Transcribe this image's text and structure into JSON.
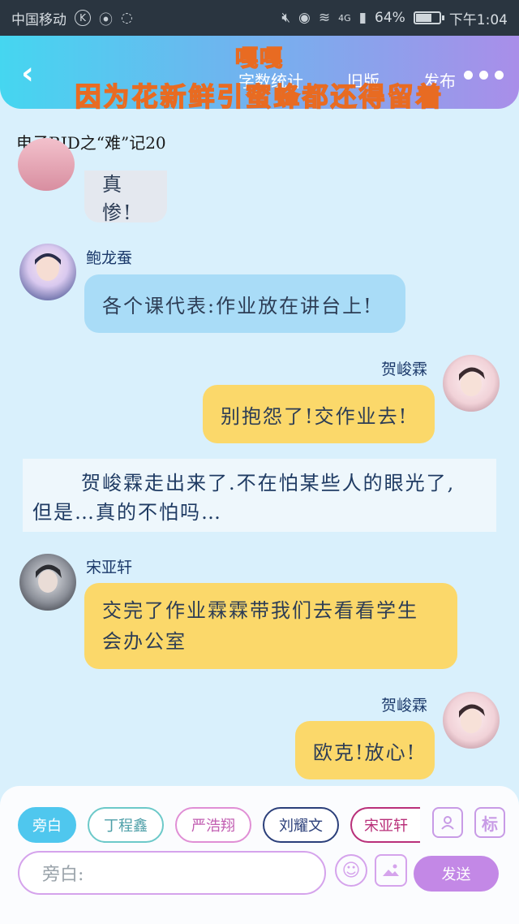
{
  "status_bar": {
    "carrier": "中国移动",
    "carrier_badge": "K",
    "battery_percent": "64%",
    "network": "4G",
    "time": "下午1:04",
    "icons": [
      "mute-icon",
      "eye-icon",
      "wifi-icon",
      "signal-icon",
      "battery-icon"
    ]
  },
  "header": {
    "back_icon": "chevron-left-icon",
    "nav": [
      "字数统计",
      "旧版",
      "发布"
    ],
    "menu_icon": "more-dots-icon",
    "overlay_line1": "嘎嘎",
    "overlay_line2": "因为花新鲜引蜜蜂都还得留着",
    "gradient_start": "#45d6f0",
    "gradient_end": "#a98ee9"
  },
  "story_title": "电子BJD之“难”记20",
  "messages": [
    {
      "side": "left",
      "name": "",
      "text": "真惨!",
      "color": "#e4e8ef"
    },
    {
      "side": "left",
      "name": "鲍龙蚕",
      "text": "各个课代表:作业放在讲台上!",
      "color": "#a9dcf7"
    },
    {
      "side": "right",
      "name": "贺峻霖",
      "text": "别抱怨了!交作业去!",
      "color": "#fbd86a"
    },
    {
      "side": "left",
      "name": "宋亚轩",
      "text_line1": "交完了作业霖霖带我们去看看学生",
      "text_line2": "会办公室",
      "color": "#fbd86a"
    },
    {
      "side": "right",
      "name": "贺峻霖",
      "text": "欧克!放心!",
      "color": "#fbd86a"
    }
  ],
  "narration": {
    "line1": "贺峻霖走出来了.不在怕某些人的眼光了,",
    "line2": "但是…真的不怕吗…"
  },
  "input_panel": {
    "chips": [
      {
        "label": "旁白",
        "color": "#4fc7ee"
      },
      {
        "label": "丁程鑫",
        "color": "#6cc9c9"
      },
      {
        "label": "严浩翔",
        "color": "#e08fd5"
      },
      {
        "label": "刘耀文",
        "color": "#2b3f7a"
      },
      {
        "label": "宋亚轩",
        "color": "#b9307a"
      }
    ],
    "role_icon": "person-card-icon",
    "tag_label": "标",
    "placeholder": "旁白:",
    "emoji_icon": "smiley-icon",
    "image_icon": "image-icon",
    "send_label": "发送"
  }
}
